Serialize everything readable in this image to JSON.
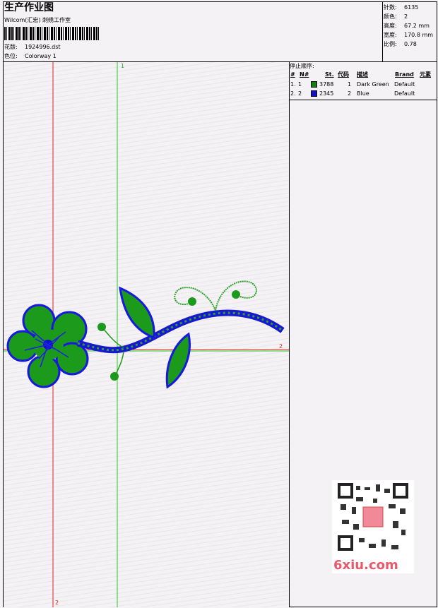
{
  "header": {
    "title": "生产作业图",
    "company": "Wilcom(汇宏) 刺绣工作室",
    "design_label": "花版:",
    "design_value": "1924996.dst",
    "colorway_label": "色位:",
    "colorway_value": "Colorway 1"
  },
  "stats": [
    {
      "label": "针数:",
      "value": "6135"
    },
    {
      "label": "颜色:",
      "value": "2"
    },
    {
      "label": "高度:",
      "value": "67.2 mm"
    },
    {
      "label": "宽度:",
      "value": "170.8 mm"
    },
    {
      "label": "比例:",
      "value": "0.78"
    }
  ],
  "stop_sequence": {
    "title": "停止顺序:",
    "columns": [
      "#",
      "N#",
      "St.",
      "代码",
      "描述",
      "Brand",
      "元素"
    ],
    "rows": [
      {
        "num": "1.",
        "n": "1",
        "color": "#108010",
        "stitches": "3788",
        "code": "1",
        "desc": "Dark Green",
        "brand": "Default"
      },
      {
        "num": "2.",
        "n": "2",
        "color": "#1010d0",
        "stitches": "2345",
        "code": "2",
        "desc": "Blue",
        "brand": "Default"
      }
    ]
  },
  "guides": {
    "v_red_label": "2",
    "v_green_label": "1",
    "h_label": "2"
  },
  "watermark": {
    "text": "6xiu.com"
  }
}
